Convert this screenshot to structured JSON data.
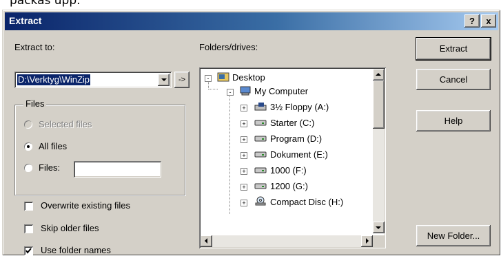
{
  "caption": "packas upp.",
  "window": {
    "title": "Extract",
    "help_button": "?",
    "close_button": "x",
    "colors": {
      "title_start": "#0a246a",
      "title_end": "#a6caf0",
      "face": "#d4d0c8"
    }
  },
  "extract_to": {
    "label": "Extract to:",
    "value": "D:\\Verktyg\\WinZip",
    "browse_button": "->"
  },
  "files_group": {
    "label": "Files",
    "options": [
      {
        "label": "Selected files",
        "checked": false,
        "enabled": false
      },
      {
        "label": "All files",
        "checked": true,
        "enabled": true
      },
      {
        "label": "Files:",
        "checked": false,
        "enabled": true
      }
    ],
    "files_input_value": ""
  },
  "checkboxes": [
    {
      "label": "Overwrite existing files",
      "checked": false
    },
    {
      "label": "Skip older files",
      "checked": false
    },
    {
      "label": "Use folder names",
      "checked": true
    }
  ],
  "folders": {
    "label": "Folders/drives:",
    "tree": [
      {
        "label": "Desktop",
        "icon": "desktop-icon",
        "level": 0,
        "toggle": "-"
      },
      {
        "label": "My Computer",
        "icon": "my-computer-icon",
        "level": 1,
        "toggle": "-"
      },
      {
        "label": "3½ Floppy (A:)",
        "icon": "floppy-drive-icon",
        "level": 2,
        "toggle": "+"
      },
      {
        "label": "Starter (C:)",
        "icon": "hard-drive-icon",
        "level": 2,
        "toggle": "+"
      },
      {
        "label": "Program (D:)",
        "icon": "hard-drive-icon",
        "level": 2,
        "toggle": "+"
      },
      {
        "label": "Dokument (E:)",
        "icon": "hard-drive-icon",
        "level": 2,
        "toggle": "+"
      },
      {
        "label": "1000 (F:)",
        "icon": "hard-drive-icon",
        "level": 2,
        "toggle": "+"
      },
      {
        "label": "1200 (G:)",
        "icon": "hard-drive-icon",
        "level": 2,
        "toggle": "+"
      },
      {
        "label": "Compact Disc (H:)",
        "icon": "cd-drive-icon",
        "level": 2,
        "toggle": "+"
      }
    ]
  },
  "buttons": {
    "extract": "Extract",
    "cancel": "Cancel",
    "help": "Help",
    "new_folder": "New Folder..."
  }
}
